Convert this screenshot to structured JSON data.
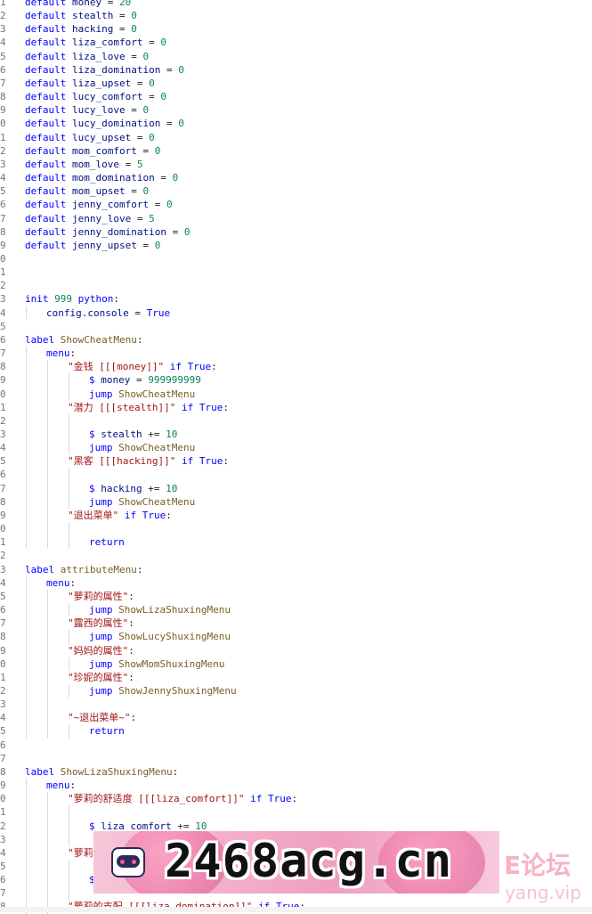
{
  "editor": {
    "lines": [
      {
        "n": "1",
        "i": 0,
        "t": [
          [
            "kw",
            "default "
          ],
          [
            "ident",
            "money"
          ],
          [
            "op",
            " = "
          ],
          [
            "num",
            "20"
          ]
        ]
      },
      {
        "n": "2",
        "i": 0,
        "t": [
          [
            "kw",
            "default "
          ],
          [
            "ident",
            "stealth"
          ],
          [
            "op",
            " = "
          ],
          [
            "num",
            "0"
          ]
        ]
      },
      {
        "n": "3",
        "i": 0,
        "t": [
          [
            "kw",
            "default "
          ],
          [
            "ident",
            "hacking"
          ],
          [
            "op",
            " = "
          ],
          [
            "num",
            "0"
          ]
        ]
      },
      {
        "n": "4",
        "i": 0,
        "t": [
          [
            "kw",
            "default "
          ],
          [
            "ident",
            "liza_comfort"
          ],
          [
            "op",
            " = "
          ],
          [
            "num",
            "0"
          ]
        ]
      },
      {
        "n": "5",
        "i": 0,
        "t": [
          [
            "kw",
            "default "
          ],
          [
            "ident",
            "liza_love"
          ],
          [
            "op",
            " = "
          ],
          [
            "num",
            "0"
          ]
        ]
      },
      {
        "n": "6",
        "i": 0,
        "t": [
          [
            "kw",
            "default "
          ],
          [
            "ident",
            "liza_domination"
          ],
          [
            "op",
            " = "
          ],
          [
            "num",
            "0"
          ]
        ]
      },
      {
        "n": "7",
        "i": 0,
        "t": [
          [
            "kw",
            "default "
          ],
          [
            "ident",
            "liza_upset"
          ],
          [
            "op",
            " = "
          ],
          [
            "num",
            "0"
          ]
        ]
      },
      {
        "n": "8",
        "i": 0,
        "t": [
          [
            "kw",
            "default "
          ],
          [
            "ident",
            "lucy_comfort"
          ],
          [
            "op",
            " = "
          ],
          [
            "num",
            "0"
          ]
        ]
      },
      {
        "n": "9",
        "i": 0,
        "t": [
          [
            "kw",
            "default "
          ],
          [
            "ident",
            "lucy_love"
          ],
          [
            "op",
            " = "
          ],
          [
            "num",
            "0"
          ]
        ]
      },
      {
        "n": "0",
        "i": 0,
        "t": [
          [
            "kw",
            "default "
          ],
          [
            "ident",
            "lucy_domination"
          ],
          [
            "op",
            " = "
          ],
          [
            "num",
            "0"
          ]
        ]
      },
      {
        "n": "1",
        "i": 0,
        "t": [
          [
            "kw",
            "default "
          ],
          [
            "ident",
            "lucy_upset"
          ],
          [
            "op",
            " = "
          ],
          [
            "num",
            "0"
          ]
        ]
      },
      {
        "n": "2",
        "i": 0,
        "t": [
          [
            "kw",
            "default "
          ],
          [
            "ident",
            "mom_comfort"
          ],
          [
            "op",
            " = "
          ],
          [
            "num",
            "0"
          ]
        ]
      },
      {
        "n": "3",
        "i": 0,
        "t": [
          [
            "kw",
            "default "
          ],
          [
            "ident",
            "mom_love"
          ],
          [
            "op",
            " = "
          ],
          [
            "num",
            "5"
          ]
        ]
      },
      {
        "n": "4",
        "i": 0,
        "t": [
          [
            "kw",
            "default "
          ],
          [
            "ident",
            "mom_domination"
          ],
          [
            "op",
            " = "
          ],
          [
            "num",
            "0"
          ]
        ]
      },
      {
        "n": "5",
        "i": 0,
        "t": [
          [
            "kw",
            "default "
          ],
          [
            "ident",
            "mom_upset"
          ],
          [
            "op",
            " = "
          ],
          [
            "num",
            "0"
          ]
        ]
      },
      {
        "n": "6",
        "i": 0,
        "t": [
          [
            "kw",
            "default "
          ],
          [
            "ident",
            "jenny_comfort"
          ],
          [
            "op",
            " = "
          ],
          [
            "num",
            "0"
          ]
        ]
      },
      {
        "n": "7",
        "i": 0,
        "t": [
          [
            "kw",
            "default "
          ],
          [
            "ident",
            "jenny_love"
          ],
          [
            "op",
            " = "
          ],
          [
            "num",
            "5"
          ]
        ]
      },
      {
        "n": "8",
        "i": 0,
        "t": [
          [
            "kw",
            "default "
          ],
          [
            "ident",
            "jenny_domination"
          ],
          [
            "op",
            " = "
          ],
          [
            "num",
            "0"
          ]
        ]
      },
      {
        "n": "9",
        "i": 0,
        "t": [
          [
            "kw",
            "default "
          ],
          [
            "ident",
            "jenny_upset"
          ],
          [
            "op",
            " = "
          ],
          [
            "num",
            "0"
          ]
        ]
      },
      {
        "n": "0",
        "i": 0,
        "t": []
      },
      {
        "n": "1",
        "i": 0,
        "t": []
      },
      {
        "n": "2",
        "i": 0,
        "t": []
      },
      {
        "n": "3",
        "i": 0,
        "t": [
          [
            "kw",
            "init "
          ],
          [
            "num",
            "999"
          ],
          [
            "kw",
            " python"
          ],
          [
            "op",
            ":"
          ]
        ]
      },
      {
        "n": "4",
        "i": 1,
        "t": [
          [
            "ident",
            "config.console"
          ],
          [
            "op",
            " = "
          ],
          [
            "kw",
            "True"
          ]
        ]
      },
      {
        "n": "5",
        "i": 0,
        "t": []
      },
      {
        "n": "6",
        "i": 0,
        "t": [
          [
            "kw",
            "label "
          ],
          [
            "fn",
            "ShowCheatMenu"
          ],
          [
            "op",
            ":"
          ]
        ]
      },
      {
        "n": "7",
        "i": 1,
        "t": [
          [
            "kw",
            "menu"
          ],
          [
            "op",
            ":"
          ]
        ]
      },
      {
        "n": "8",
        "i": 2,
        "t": [
          [
            "str",
            "\"金钱 [[[money]]\""
          ],
          [
            "kw",
            " if "
          ],
          [
            "kw",
            "True"
          ],
          [
            "op",
            ":"
          ]
        ]
      },
      {
        "n": "9",
        "i": 3,
        "t": [
          [
            "dollar",
            "$ "
          ],
          [
            "ident",
            "money"
          ],
          [
            "op",
            " = "
          ],
          [
            "num",
            "999999999"
          ]
        ]
      },
      {
        "n": "0",
        "i": 3,
        "t": [
          [
            "kw",
            "jump "
          ],
          [
            "fn",
            "ShowCheatMenu"
          ]
        ]
      },
      {
        "n": "1",
        "i": 2,
        "t": [
          [
            "str",
            "\"潜力 [[[stealth]]\""
          ],
          [
            "kw",
            " if "
          ],
          [
            "kw",
            "True"
          ],
          [
            "op",
            ":"
          ]
        ]
      },
      {
        "n": "2",
        "i": 3,
        "t": []
      },
      {
        "n": "3",
        "i": 3,
        "t": [
          [
            "dollar",
            "$ "
          ],
          [
            "ident",
            "stealth"
          ],
          [
            "op",
            " += "
          ],
          [
            "num",
            "10"
          ]
        ]
      },
      {
        "n": "4",
        "i": 3,
        "t": [
          [
            "kw",
            "jump "
          ],
          [
            "fn",
            "ShowCheatMenu"
          ]
        ]
      },
      {
        "n": "5",
        "i": 2,
        "t": [
          [
            "str",
            "\"黑客 [[[hacking]]\""
          ],
          [
            "kw",
            " if "
          ],
          [
            "kw",
            "True"
          ],
          [
            "op",
            ":"
          ]
        ]
      },
      {
        "n": "6",
        "i": 3,
        "t": []
      },
      {
        "n": "7",
        "i": 3,
        "t": [
          [
            "dollar",
            "$ "
          ],
          [
            "ident",
            "hacking"
          ],
          [
            "op",
            " += "
          ],
          [
            "num",
            "10"
          ]
        ]
      },
      {
        "n": "8",
        "i": 3,
        "t": [
          [
            "kw",
            "jump "
          ],
          [
            "fn",
            "ShowCheatMenu"
          ]
        ]
      },
      {
        "n": "9",
        "i": 2,
        "t": [
          [
            "str",
            "\"退出菜单\""
          ],
          [
            "kw",
            " if "
          ],
          [
            "kw",
            "True"
          ],
          [
            "op",
            ":"
          ]
        ]
      },
      {
        "n": "0",
        "i": 3,
        "t": []
      },
      {
        "n": "1",
        "i": 3,
        "t": [
          [
            "kw",
            "return"
          ]
        ]
      },
      {
        "n": "2",
        "i": 0,
        "t": []
      },
      {
        "n": "3",
        "i": 0,
        "t": [
          [
            "kw",
            "label "
          ],
          [
            "fn",
            "attributeMenu"
          ],
          [
            "op",
            ":"
          ]
        ]
      },
      {
        "n": "4",
        "i": 1,
        "t": [
          [
            "kw",
            "menu"
          ],
          [
            "op",
            ":"
          ]
        ]
      },
      {
        "n": "5",
        "i": 2,
        "t": [
          [
            "str",
            "\"萝莉的属性\""
          ],
          [
            "op",
            ":"
          ]
        ]
      },
      {
        "n": "6",
        "i": 3,
        "t": [
          [
            "kw",
            "jump "
          ],
          [
            "fn",
            "ShowLizaShuxingMenu"
          ]
        ]
      },
      {
        "n": "7",
        "i": 2,
        "t": [
          [
            "str",
            "\"露西的属性\""
          ],
          [
            "op",
            ":"
          ]
        ]
      },
      {
        "n": "8",
        "i": 3,
        "t": [
          [
            "kw",
            "jump "
          ],
          [
            "fn",
            "ShowLucyShuxingMenu"
          ]
        ]
      },
      {
        "n": "9",
        "i": 2,
        "t": [
          [
            "str",
            "\"妈妈的属性\""
          ],
          [
            "op",
            ":"
          ]
        ]
      },
      {
        "n": "0",
        "i": 3,
        "t": [
          [
            "kw",
            "jump "
          ],
          [
            "fn",
            "ShowMomShuxingMenu"
          ]
        ]
      },
      {
        "n": "1",
        "i": 2,
        "t": [
          [
            "str",
            "\"珍妮的属性\""
          ],
          [
            "op",
            ":"
          ]
        ]
      },
      {
        "n": "2",
        "i": 3,
        "t": [
          [
            "kw",
            "jump "
          ],
          [
            "fn",
            "ShowJennyShuxingMenu"
          ]
        ]
      },
      {
        "n": "3",
        "i": 2,
        "t": []
      },
      {
        "n": "4",
        "i": 2,
        "t": [
          [
            "str",
            "\"~退出菜单~\""
          ],
          [
            "op",
            ":"
          ]
        ]
      },
      {
        "n": "5",
        "i": 3,
        "t": [
          [
            "kw",
            "return"
          ]
        ]
      },
      {
        "n": "6",
        "i": 0,
        "t": []
      },
      {
        "n": "7",
        "i": 0,
        "t": []
      },
      {
        "n": "8",
        "i": 0,
        "t": [
          [
            "kw",
            "label "
          ],
          [
            "fn",
            "ShowLizaShuxingMenu"
          ],
          [
            "op",
            ":"
          ]
        ]
      },
      {
        "n": "9",
        "i": 1,
        "t": [
          [
            "kw",
            "menu"
          ],
          [
            "op",
            ":"
          ]
        ]
      },
      {
        "n": "0",
        "i": 2,
        "t": [
          [
            "str",
            "\"萝莉的舒适度 [[[liza_comfort]]\""
          ],
          [
            "kw",
            " if "
          ],
          [
            "kw",
            "True"
          ],
          [
            "op",
            ":"
          ]
        ]
      },
      {
        "n": "1",
        "i": 3,
        "t": []
      },
      {
        "n": "2",
        "i": 3,
        "t": [
          [
            "dollar",
            "$ "
          ],
          [
            "ident",
            "liza_comfort"
          ],
          [
            "op",
            " += "
          ],
          [
            "num",
            "10"
          ]
        ]
      },
      {
        "n": "3",
        "i": 3,
        "t": []
      },
      {
        "n": "4",
        "i": 2,
        "t": [
          [
            "str",
            "\"萝莉"
          ]
        ]
      },
      {
        "n": "5",
        "i": 3,
        "t": []
      },
      {
        "n": "6",
        "i": 3,
        "t": [
          [
            "dollar",
            "$"
          ]
        ]
      },
      {
        "n": "7",
        "i": 3,
        "t": []
      },
      {
        "n": "8",
        "i": 2,
        "t": [
          [
            "str",
            "\"萝莉的支配 [[[liza_domination]]\""
          ],
          [
            "kw",
            " if "
          ],
          [
            "kw",
            "True"
          ],
          [
            "op",
            ":"
          ]
        ]
      }
    ]
  },
  "banner": {
    "text": "2468acg.cn",
    "watermark_top": "E论坛",
    "watermark_bottom": "yang.vip"
  },
  "colors": {
    "keyword": "#0000ff",
    "string": "#a31515",
    "number": "#098658",
    "label_name": "#795e26",
    "identifier": "#001080"
  }
}
